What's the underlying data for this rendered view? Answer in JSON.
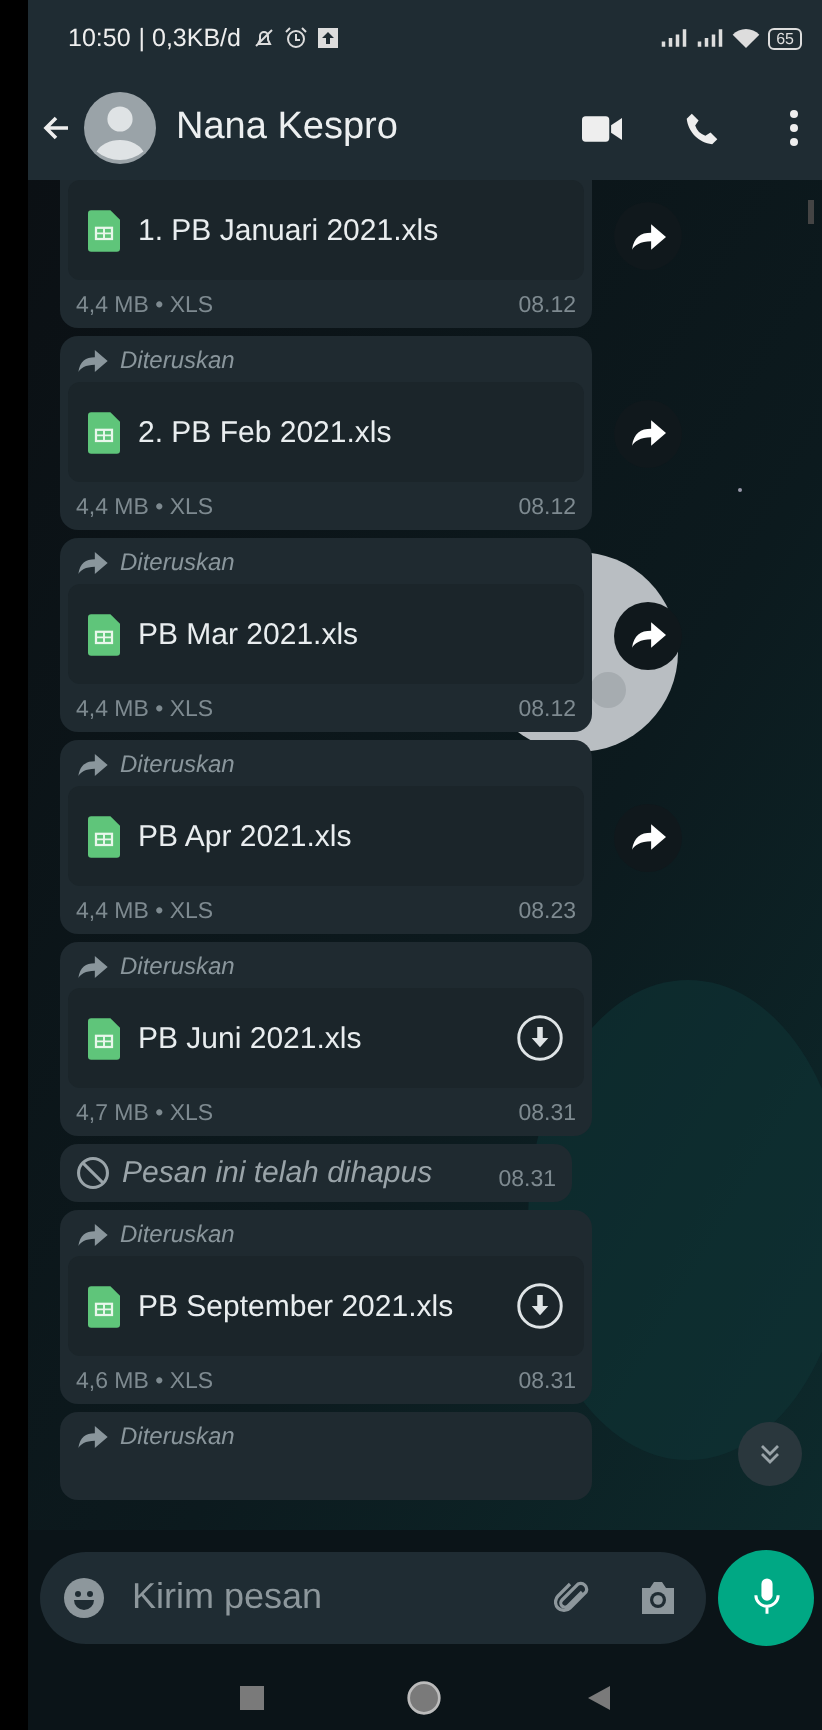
{
  "status_bar": {
    "time": "10:50",
    "data_rate": "| 0,3KB/d",
    "battery": "65"
  },
  "header": {
    "contact_name": "Nana Kespro"
  },
  "messages": [
    {
      "kind": "file",
      "forwarded": false,
      "file_name": "1. PB Januari 2021.xls",
      "details": "4,4 MB • XLS",
      "time": "08.12",
      "downloaded": true
    },
    {
      "kind": "file",
      "forwarded": true,
      "forwarded_label": "Diteruskan",
      "file_name": "2. PB Feb 2021.xls",
      "details": "4,4 MB • XLS",
      "time": "08.12",
      "downloaded": true
    },
    {
      "kind": "file",
      "forwarded": true,
      "forwarded_label": "Diteruskan",
      "file_name": "PB Mar 2021.xls",
      "details": "4,4 MB • XLS",
      "time": "08.12",
      "downloaded": true
    },
    {
      "kind": "file",
      "forwarded": true,
      "forwarded_label": "Diteruskan",
      "file_name": "PB Apr 2021.xls",
      "details": "4,4 MB • XLS",
      "time": "08.23",
      "downloaded": true
    },
    {
      "kind": "file",
      "forwarded": true,
      "forwarded_label": "Diteruskan",
      "file_name": "PB Juni 2021.xls",
      "details": "4,7 MB • XLS",
      "time": "08.31",
      "downloaded": false
    },
    {
      "kind": "deleted",
      "text": "Pesan ini telah dihapus",
      "time": "08.31"
    },
    {
      "kind": "file",
      "forwarded": true,
      "forwarded_label": "Diteruskan",
      "file_name": "PB September 2021.xls",
      "details": "4,6 MB • XLS",
      "time": "08.31",
      "downloaded": false
    },
    {
      "kind": "partial",
      "forwarded": true,
      "forwarded_label": "Diteruskan"
    }
  ],
  "composer": {
    "placeholder": "Kirim pesan"
  }
}
